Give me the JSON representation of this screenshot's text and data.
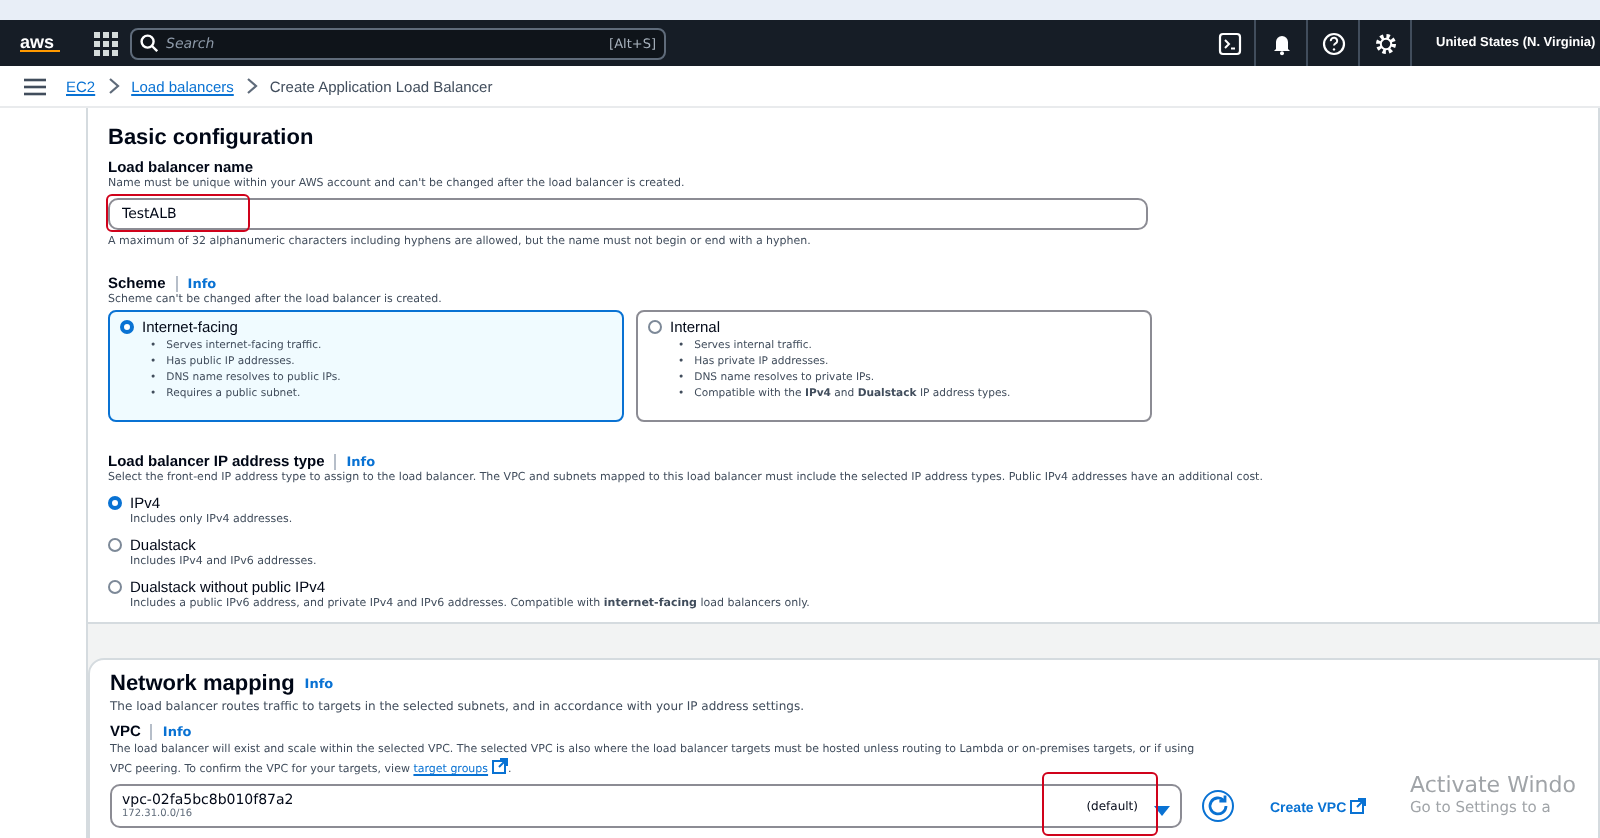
{
  "top_nav": {
    "logo": "aws",
    "search": {
      "placeholder": "Search",
      "shortcut": "[Alt+S]"
    },
    "region": "United States (N. Virginia)"
  },
  "breadcrumb": [
    {
      "label": "EC2",
      "link": true
    },
    {
      "label": "Load balancers",
      "link": true
    },
    {
      "label": "Create Application Load Balancer",
      "link": false
    }
  ],
  "basic_configuration": {
    "title": "Basic configuration",
    "name_field": {
      "label": "Load balancer name",
      "hint": "Name must be unique within your AWS account and can't be changed after the load balancer is created.",
      "value": "TestALB",
      "constraint": "A maximum of 32 alphanumeric characters including hyphens are allowed, but the name must not begin or end with a hyphen.",
      "highlighted": true
    },
    "scheme": {
      "label": "Scheme",
      "info": "Info",
      "bullet_marker": "•",
      "hint": "Scheme can't be changed after the load balancer is created.",
      "options": [
        {
          "label": "Internet-facing",
          "selected": true,
          "bullets": [
            "Serves internet-facing traffic.",
            "Has public IP addresses.",
            "DNS name resolves to public IPs.",
            "Requires a public subnet."
          ]
        },
        {
          "label": "Internal",
          "selected": false,
          "bullets": [
            "Serves internal traffic.",
            "Has private IP addresses.",
            "DNS name resolves to private IPs.",
            "Compatible with the **IPv4** and **Dualstack** IP address types."
          ]
        }
      ]
    },
    "ip_address_type": {
      "label": "Load balancer IP address type",
      "info": "Info",
      "hint": "Select the front-end IP address type to assign to the load balancer. The VPC and subnets mapped to this load balancer must include the selected IP address types. Public IPv4 addresses have an additional cost.",
      "options": [
        {
          "label": "IPv4",
          "description": "Includes only IPv4 addresses.",
          "selected": true
        },
        {
          "label": "Dualstack",
          "description": "Includes IPv4 and IPv6 addresses.",
          "selected": false
        },
        {
          "label": "Dualstack without public IPv4",
          "description": "Includes a public IPv6 address, and private IPv4 and IPv6 addresses. Compatible with **internet-facing** load balancers only.",
          "selected": false
        }
      ]
    }
  },
  "network_mapping": {
    "title": "Network mapping",
    "info": "Info",
    "description": "The load balancer routes traffic to targets in the selected subnets, and in accordance with your IP address settings.",
    "vpc": {
      "label": "VPC",
      "info": "Info",
      "hint": "The load balancer will exist and scale within the selected VPC. The selected VPC is also where the load balancer targets must be hosted unless routing to Lambda or on-premises targets, or if using VPC peering. To confirm the VPC for your targets, view",
      "hint_link": "target groups",
      "hint_end": ".",
      "value": "vpc-02fa5bc8b010f87a2",
      "cidr": "172.31.0.0/16",
      "tag": "(default)",
      "highlighted": true,
      "create_button": "Create VPC"
    }
  },
  "os_overlay": {
    "title": "Activate Windo",
    "subtitle": "Go to Settings to a"
  }
}
